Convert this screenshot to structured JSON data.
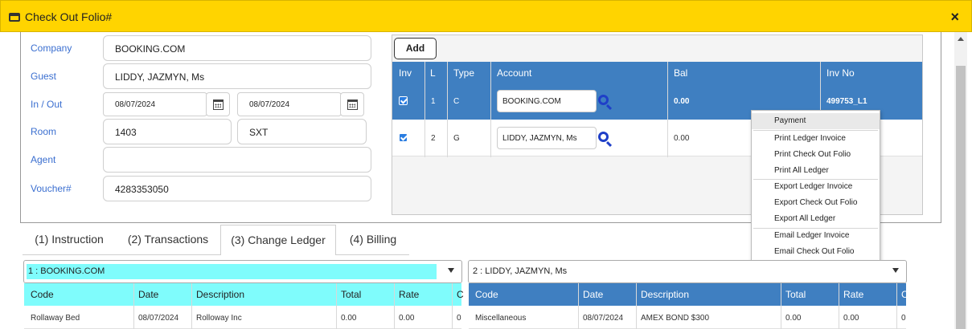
{
  "window": {
    "title": "Check Out Folio#",
    "close_icon": "×"
  },
  "form": {
    "company_label": "Company",
    "company_value": "BOOKING.COM",
    "guest_label": "Guest",
    "guest_value": "LIDDY, JAZMYN, Ms",
    "inout_label": "In / Out",
    "in_date": "08/07/2024",
    "out_date": "08/07/2024",
    "room_label": "Room",
    "room_value": "1403",
    "room_type": "SXT",
    "agent_label": "Agent",
    "agent_value": "",
    "voucher_label": "Voucher#",
    "voucher_value": "4283353050"
  },
  "ledger": {
    "add_label": "Add",
    "columns": [
      "Inv",
      "L",
      "Type",
      "Account",
      "Bal",
      "Inv No"
    ],
    "rows": [
      {
        "inv": true,
        "l": "1",
        "type": "C",
        "account": "BOOKING.COM",
        "bal": "0.00",
        "inv_no": "499753_L1"
      },
      {
        "inv": true,
        "l": "2",
        "type": "G",
        "account": "LIDDY, JAZMYN, Ms",
        "bal": "0.00",
        "inv_no": ""
      }
    ]
  },
  "context_menu": {
    "items": [
      "Payment",
      "Print Ledger Invoice",
      "Print Check Out Folio",
      "Print All Ledger",
      "Export Ledger Invoice",
      "Export Check Out Folio",
      "Export All Ledger",
      "Email Ledger Invoice",
      "Email Check Out Folio"
    ],
    "highlighted": "Payment"
  },
  "tabs": [
    "(1) Instruction",
    "(2) Transactions",
    "(3) Change Ledger",
    "(4) Billing"
  ],
  "active_tab": "(3) Change Ledger",
  "left_table": {
    "selector": "1 : BOOKING.COM",
    "columns": [
      "Code",
      "Date",
      "Description",
      "Total",
      "Rate",
      "C"
    ],
    "row": [
      "Rollaway Bed",
      "08/07/2024",
      "Rolloway Inc",
      "0.00",
      "0.00",
      "0"
    ],
    "header_color": "#7ffcfc"
  },
  "right_table": {
    "selector": "2 : LIDDY, JAZMYN, Ms",
    "columns": [
      "Code",
      "Date",
      "Description",
      "Total",
      "Rate",
      "C"
    ],
    "row": [
      "Miscellaneous",
      "08/07/2024",
      "AMEX BOND $300",
      "0.00",
      "0.00",
      "0"
    ],
    "header_color": "#3f7fc1"
  },
  "colors": {
    "titlebar": "#ffd400",
    "label": "#3b6fd0",
    "ledger_head": "#3f7fc1",
    "cyan": "#7ffcfc"
  }
}
